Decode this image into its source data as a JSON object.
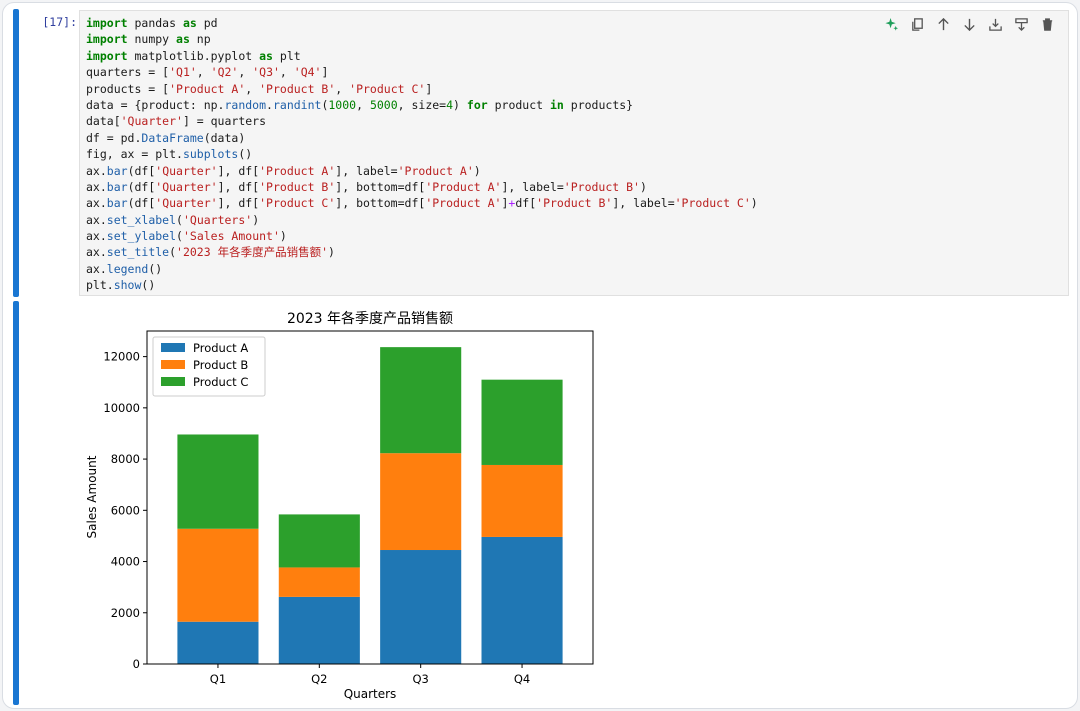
{
  "cell": {
    "prompt": "[17]:",
    "code_lines": [
      [
        [
          "kw",
          "import"
        ],
        [
          "t",
          " pandas "
        ],
        [
          "kw",
          "as"
        ],
        [
          "t",
          " pd"
        ]
      ],
      [
        [
          "kw",
          "import"
        ],
        [
          "t",
          " numpy "
        ],
        [
          "kw",
          "as"
        ],
        [
          "t",
          " np"
        ]
      ],
      [
        [
          "kw",
          "import"
        ],
        [
          "t",
          " matplotlib.pyplot "
        ],
        [
          "kw",
          "as"
        ],
        [
          "t",
          " plt"
        ]
      ],
      [
        [
          "t",
          "quarters = ["
        ],
        [
          "str",
          "'Q1'"
        ],
        [
          "t",
          ", "
        ],
        [
          "str",
          "'Q2'"
        ],
        [
          "t",
          ", "
        ],
        [
          "str",
          "'Q3'"
        ],
        [
          "t",
          ", "
        ],
        [
          "str",
          "'Q4'"
        ],
        [
          "t",
          "]"
        ]
      ],
      [
        [
          "t",
          "products = ["
        ],
        [
          "str",
          "'Product A'"
        ],
        [
          "t",
          ", "
        ],
        [
          "str",
          "'Product B'"
        ],
        [
          "t",
          ", "
        ],
        [
          "str",
          "'Product C'"
        ],
        [
          "t",
          "]"
        ]
      ],
      [
        [
          "t",
          "data = {product: np."
        ],
        [
          "fn",
          "random"
        ],
        [
          "t",
          "."
        ],
        [
          "fn",
          "randint"
        ],
        [
          "t",
          "("
        ],
        [
          "num",
          "1000"
        ],
        [
          "t",
          ", "
        ],
        [
          "num",
          "5000"
        ],
        [
          "t",
          ", size="
        ],
        [
          "num",
          "4"
        ],
        [
          "t",
          ") "
        ],
        [
          "kw",
          "for"
        ],
        [
          "t",
          " product "
        ],
        [
          "kw",
          "in"
        ],
        [
          "t",
          " products}"
        ]
      ],
      [
        [
          "t",
          "data["
        ],
        [
          "str",
          "'Quarter'"
        ],
        [
          "t",
          "] = quarters"
        ]
      ],
      [
        [
          "t",
          "df = pd."
        ],
        [
          "fn",
          "DataFrame"
        ],
        [
          "t",
          "(data)"
        ]
      ],
      [
        [
          "t",
          "fig, ax = plt."
        ],
        [
          "fn",
          "subplots"
        ],
        [
          "t",
          "()"
        ]
      ],
      [
        [
          "t",
          "ax."
        ],
        [
          "fn",
          "bar"
        ],
        [
          "t",
          "(df["
        ],
        [
          "str",
          "'Quarter'"
        ],
        [
          "t",
          "], df["
        ],
        [
          "str",
          "'Product A'"
        ],
        [
          "t",
          "], label="
        ],
        [
          "str",
          "'Product A'"
        ],
        [
          "t",
          ")"
        ]
      ],
      [
        [
          "t",
          "ax."
        ],
        [
          "fn",
          "bar"
        ],
        [
          "t",
          "(df["
        ],
        [
          "str",
          "'Quarter'"
        ],
        [
          "t",
          "], df["
        ],
        [
          "str",
          "'Product B'"
        ],
        [
          "t",
          "], bottom=df["
        ],
        [
          "str",
          "'Product A'"
        ],
        [
          "t",
          "], label="
        ],
        [
          "str",
          "'Product B'"
        ],
        [
          "t",
          ")"
        ]
      ],
      [
        [
          "t",
          "ax."
        ],
        [
          "fn",
          "bar"
        ],
        [
          "t",
          "(df["
        ],
        [
          "str",
          "'Quarter'"
        ],
        [
          "t",
          "], df["
        ],
        [
          "str",
          "'Product C'"
        ],
        [
          "t",
          "], bottom=df["
        ],
        [
          "str",
          "'Product A'"
        ],
        [
          "t",
          "]"
        ],
        [
          "op",
          "+"
        ],
        [
          "t",
          "df["
        ],
        [
          "str",
          "'Product B'"
        ],
        [
          "t",
          "], label="
        ],
        [
          "str",
          "'Product C'"
        ],
        [
          "t",
          ")"
        ]
      ],
      [
        [
          "t",
          "ax."
        ],
        [
          "fn",
          "set_xlabel"
        ],
        [
          "t",
          "("
        ],
        [
          "str",
          "'Quarters'"
        ],
        [
          "t",
          ")"
        ]
      ],
      [
        [
          "t",
          "ax."
        ],
        [
          "fn",
          "set_ylabel"
        ],
        [
          "t",
          "("
        ],
        [
          "str",
          "'Sales Amount'"
        ],
        [
          "t",
          ")"
        ]
      ],
      [
        [
          "t",
          "ax."
        ],
        [
          "fn",
          "set_title"
        ],
        [
          "t",
          "("
        ],
        [
          "str",
          "'2023 年各季度产品销售额'"
        ],
        [
          "t",
          ")"
        ]
      ],
      [
        [
          "t",
          "ax."
        ],
        [
          "fn",
          "legend"
        ],
        [
          "t",
          "()"
        ]
      ],
      [
        [
          "t",
          "plt."
        ],
        [
          "fn",
          "show"
        ],
        [
          "t",
          "()"
        ]
      ]
    ]
  },
  "toolbar": [
    {
      "name": "sparkle-icon",
      "color": "#1e9e5a"
    },
    {
      "name": "copy-icon",
      "color": "#555555"
    },
    {
      "name": "arrow-up-icon",
      "color": "#555555"
    },
    {
      "name": "arrow-down-icon",
      "color": "#555555"
    },
    {
      "name": "insert-above-icon",
      "color": "#555555"
    },
    {
      "name": "insert-below-icon",
      "color": "#555555"
    },
    {
      "name": "trash-icon",
      "color": "#555555"
    }
  ],
  "chart_data": {
    "type": "bar",
    "stacked": true,
    "title": "2023 年各季度产品销售额",
    "xlabel": "Quarters",
    "ylabel": "Sales Amount",
    "categories": [
      "Q1",
      "Q2",
      "Q3",
      "Q4"
    ],
    "ylim": [
      0,
      13000
    ],
    "yticks": [
      0,
      2000,
      4000,
      6000,
      8000,
      10000,
      12000
    ],
    "legend_position": "top-left",
    "grid": false,
    "series": [
      {
        "name": "Product A",
        "color": "#1f77b4",
        "values": [
          1650,
          2620,
          4450,
          4960
        ]
      },
      {
        "name": "Product B",
        "color": "#ff7f0e",
        "values": [
          3630,
          1150,
          3780,
          2810
        ]
      },
      {
        "name": "Product C",
        "color": "#2ca02c",
        "values": [
          3680,
          2070,
          4140,
          3330
        ]
      }
    ]
  }
}
